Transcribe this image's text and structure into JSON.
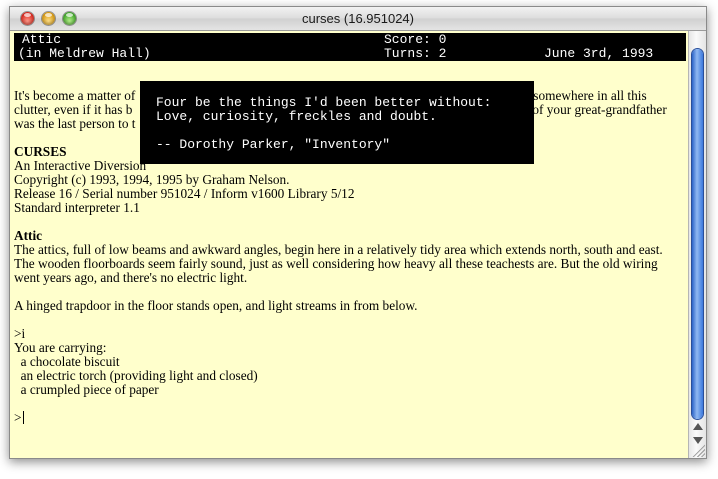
{
  "window": {
    "title": "curses (16.951024)"
  },
  "status": {
    "location": "Attic",
    "sublocation": "(in Meldrew Hall)",
    "score": "Score: 0",
    "turns": "Turns: 2",
    "date": "June 3rd, 1993"
  },
  "quote": {
    "line1": "Four be the things I'd been better without:",
    "line2": "Love, curiosity, freckles and doubt.",
    "attribution": "-- Dorothy Parker, \"Inventory\""
  },
  "transcript": {
    "intro_line1_left": "It's become a matter of",
    "intro_line1_right": "somewhere in all this",
    "intro_line2_left": "clutter, even if it has b",
    "intro_line2_right": "of your great-grandfather",
    "intro_line3_left": "was the last person to t",
    "game_title": "CURSES",
    "subtitle": "An Interactive Diversion",
    "copyright": "Copyright (c) 1993, 1994, 1995 by Graham Nelson.",
    "release": "Release 16 / Serial number 951024 / Inform v1600 Library 5/12",
    "interpreter": "Standard interpreter 1.1",
    "room_name": "Attic",
    "room_desc": "The attics, full of low beams and awkward angles, begin here in a relatively tidy area which extends north, south and east. The wooden floorboards seem fairly sound, just as well considering how heavy all these teachests are. But the old wiring went years ago, and there's no electric light.",
    "trapdoor": "A hinged trapdoor in the floor stands open, and light streams in from below.",
    "command": ">i",
    "carrying": "You are carrying:",
    "items": [
      "  a chocolate biscuit",
      "  an electric torch (providing light and closed)",
      "  a crumpled piece of paper"
    ],
    "prompt": ">"
  }
}
